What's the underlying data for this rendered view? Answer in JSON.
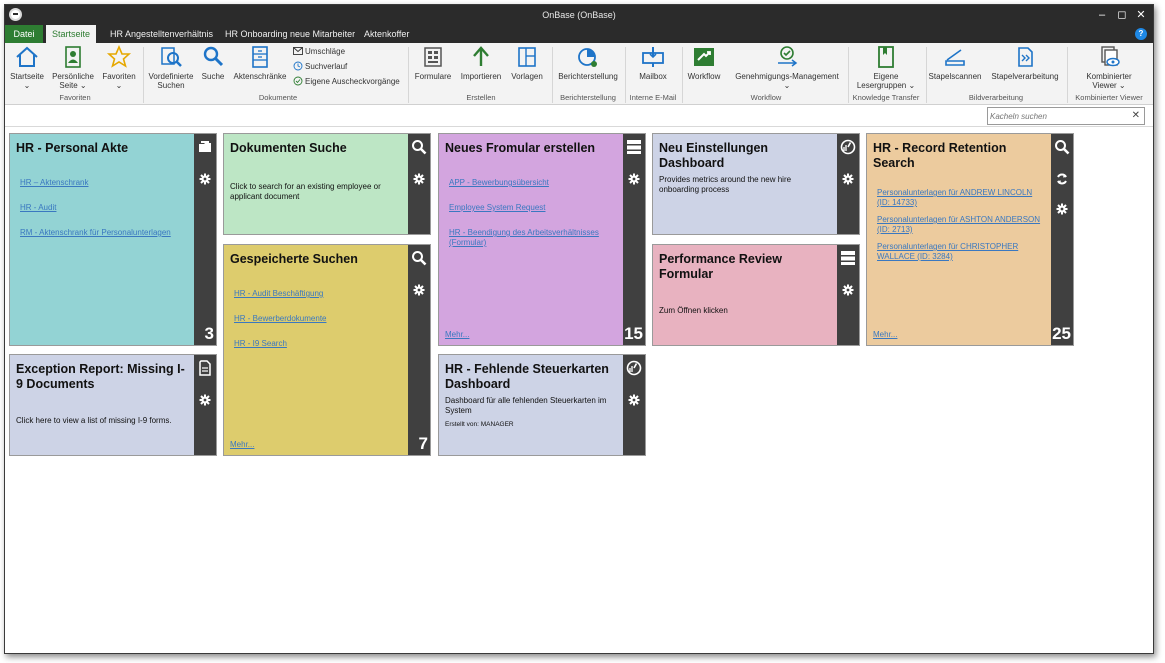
{
  "window": {
    "title": "OnBase (OnBase)"
  },
  "window_controls": {
    "minimize": "–",
    "maximize": "◻",
    "close": "✕"
  },
  "menu": {
    "file": "Datei",
    "tabs": [
      "Startseite",
      "HR Angestelltenverhältnis",
      "HR Onboarding neue Mitarbeiter",
      "Aktenkoffer"
    ],
    "help": "?"
  },
  "ribbon": {
    "favoriten": {
      "label": "Favoriten",
      "startseite": "Startseite",
      "persoenliche": "Persönliche",
      "seite": "Seite",
      "favoriten": "Favoriten"
    },
    "dokumente": {
      "label": "Dokumente",
      "vordefinierte": "Vordefinierte",
      "suchen": "Suchen",
      "suche": "Suche",
      "aktenschraenke": "Aktenschränke",
      "umschlaege": "Umschläge",
      "suchverlauf": "Suchverlauf",
      "ausgecheckt": "Eigene Auscheckvorgänge"
    },
    "erstellen": {
      "label": "Erstellen",
      "formulare": "Formulare",
      "importieren": "Importieren",
      "vorlagen": "Vorlagen"
    },
    "berichterstellung": {
      "label": "Berichterstellung",
      "button": "Berichterstellung"
    },
    "email": {
      "label": "Interne E-Mail",
      "mailbox": "Mailbox"
    },
    "workflow": {
      "label": "Workflow",
      "workflow": "Workflow",
      "genehmigung": "Genehmigungs-Management"
    },
    "knowledge": {
      "label": "Knowledge Transfer",
      "eigene": "Eigene",
      "lesergruppen": "Lesergruppen"
    },
    "bildverarbeitung": {
      "label": "Bildverarbeitung",
      "stapelscannen": "Stapelscannen",
      "stapelverarbeitung": "Stapelverarbeitung"
    },
    "viewer": {
      "label": "Kombinierter Viewer",
      "kombinierter": "Kombinierter",
      "viewer": "Viewer"
    }
  },
  "search": {
    "placeholder": "Kacheln suchen",
    "clear": "✕"
  },
  "tiles": {
    "personal_akte": {
      "title": "HR - Personal Akte",
      "links": [
        "HR – Aktenschrank",
        "HR - Audit",
        "RM - Aktenschrank für Personalunterlagen"
      ],
      "count": "3",
      "color": "#93d3d4"
    },
    "dokumenten_suche": {
      "title": "Dokumenten Suche",
      "desc": "Click to search for an existing employee or applicant document",
      "color": "#bde6c5"
    },
    "neues_formular": {
      "title": "Neues Fromular erstellen",
      "links": [
        "APP - Bewerbungsübersicht",
        "Employee System Request",
        "HR - Beendigung des Arbeitsverhältnisses (Formular)"
      ],
      "more": "Mehr...",
      "count": "15",
      "color": "#d3a5df"
    },
    "neu_einstellungen": {
      "title": "Neu Einstellungen Dashboard",
      "desc": "Provides metrics around the new hire onboarding process",
      "color": "#cdd3e6"
    },
    "record_retention": {
      "title": "HR - Record Retention Search",
      "links": [
        "Personalunterlagen für ANDREW LINCOLN (ID: 14733)",
        "Personalunterlagen für ASHTON ANDERSON (ID: 2713)",
        "Personalunterlagen für CHRISTOPHER WALLACE (ID: 3284)"
      ],
      "more": "Mehr...",
      "count": "25",
      "color": "#eccb9e"
    },
    "gespeicherte_suchen": {
      "title": "Gespeicherte Suchen",
      "links": [
        "HR - Audit Beschäftigung",
        "HR - Bewerberdokumente",
        "HR - I9 Search"
      ],
      "more": "Mehr...",
      "count": "7",
      "color": "#ddcc6d"
    },
    "performance_review": {
      "title": "Performance Review Formular",
      "desc": "Zum Öffnen klicken",
      "color": "#e8b2c0"
    },
    "exception_report": {
      "title": "Exception Report: Missing I-9 Documents",
      "desc": "Click here to view a list of missing I-9 forms.",
      "color": "#cdd3e6"
    },
    "fehlende_steuerkarten": {
      "title": "HR - Fehlende Steuerkarten Dashboard",
      "desc": "Dashboard für alle fehlenden Steuerkarten im System",
      "created": "Erstellt von: MANAGER",
      "color": "#cdd3e6"
    }
  },
  "colors": {
    "brand_green": "#2e7d32",
    "ribbon_blue": "#1e74c8",
    "side_bar": "#404040"
  }
}
